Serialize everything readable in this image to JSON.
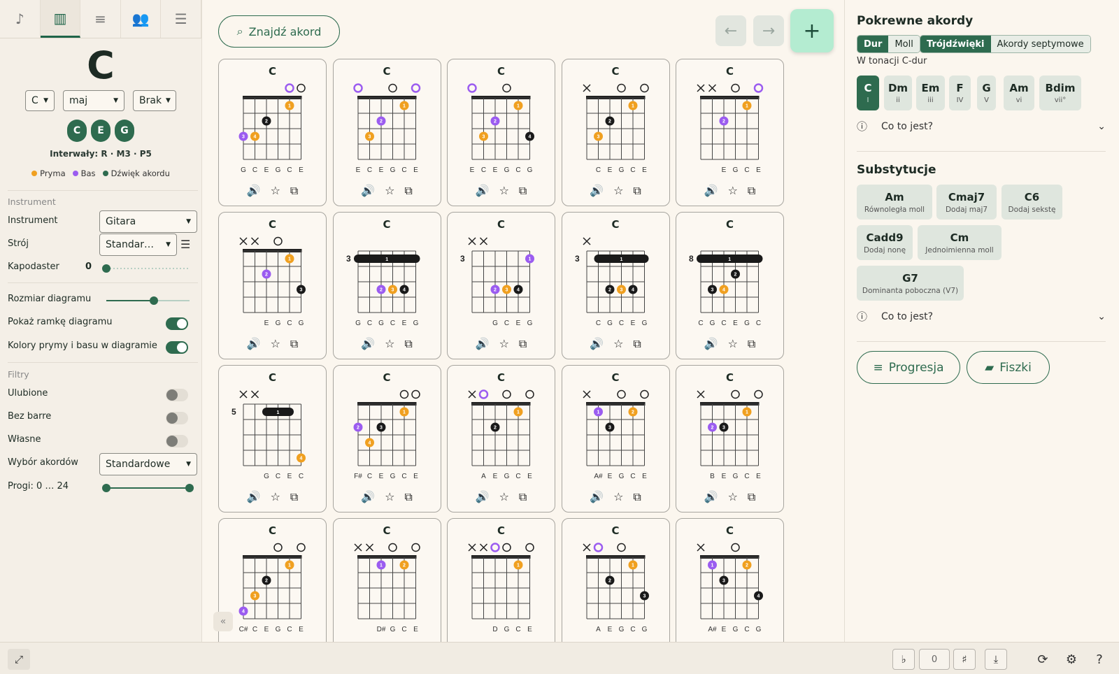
{
  "left": {
    "tabs": [
      "note-icon",
      "piano-icon",
      "playlist-icon",
      "people-icon",
      "sliders-icon"
    ],
    "chord_root": "C",
    "root_select": "C",
    "quality_select": "maj",
    "bass_select": "Brak",
    "notes": [
      "C",
      "E",
      "G"
    ],
    "intervals": "Interwały: R · M3 · P5",
    "legend": {
      "root": "Pryma",
      "bass": "Bas",
      "tone": "Dźwięk akordu"
    },
    "instrument_header": "Instrument",
    "instrument_label": "Instrument",
    "instrument_value": "Gitara",
    "tuning_label": "Strój",
    "tuning_value": "Standar…",
    "capo_label": "Kapodaster",
    "capo_value": "0",
    "size_label": "Rozmiar diagramu",
    "frame_label": "Pokaż ramkę diagramu",
    "colors_label": "Kolory prymy i basu w diagramie",
    "filters_header": "Filtry",
    "fav_label": "Ulubione",
    "nobarre_label": "Bez barre",
    "own_label": "Własne",
    "choice_label": "Wybór akordów",
    "choice_value": "Standardowe",
    "frets_label": "Progi: 0 … 24"
  },
  "center": {
    "find_label": "Znajdź akord",
    "chord_name": "C"
  },
  "right": {
    "related_title": "Pokrewne akordy",
    "seg1": [
      "Dur",
      "Moll"
    ],
    "seg2": [
      "Trójdźwięki",
      "Akordy septymowe"
    ],
    "key_label": "W tonacji C-dur",
    "keys": [
      {
        "name": "C",
        "deg": "I"
      },
      {
        "name": "Dm",
        "deg": "ii"
      },
      {
        "name": "Em",
        "deg": "iii"
      },
      {
        "name": "F",
        "deg": "IV"
      },
      {
        "name": "G",
        "deg": "V"
      },
      {
        "name": "Am",
        "deg": "vi"
      },
      {
        "name": "Bdim",
        "deg": "vii°"
      }
    ],
    "what_is": "Co to jest?",
    "subs_title": "Substytucje",
    "subs": [
      {
        "name": "Am",
        "desc": "Równoległa moll"
      },
      {
        "name": "Cmaj7",
        "desc": "Dodaj maj7"
      },
      {
        "name": "C6",
        "desc": "Dodaj sekstę"
      },
      {
        "name": "Cadd9",
        "desc": "Dodaj nonę"
      },
      {
        "name": "Cm",
        "desc": "Jednoimienna moll"
      },
      {
        "name": "G7",
        "desc": "Dominanta poboczna (V7)"
      }
    ],
    "what_is2": "Co to jest?",
    "progression_label": "Progresja",
    "flashcards_label": "Fiszki"
  },
  "bottom": {
    "flat": "♭",
    "transpose": "0",
    "sharp": "♯"
  },
  "colors": {
    "accent": "#2e6b4f",
    "root": "#f0a020",
    "bass": "#9b5cf0",
    "tone": "#1a1a1a"
  },
  "chords": [
    {
      "strings": [
        "",
        "",
        "",
        "",
        "B",
        "O"
      ],
      "fret": null,
      "barre": null,
      "dots": [
        [
          1,
          5,
          1,
          "r"
        ],
        [
          2,
          3,
          2,
          "t"
        ],
        [
          3,
          2,
          4,
          "r"
        ],
        [
          3,
          1,
          3,
          "b"
        ]
      ],
      "names": [
        "G",
        "C",
        "E",
        "G",
        "C",
        "E"
      ]
    },
    {
      "strings": [
        "B",
        "",
        "",
        "O",
        "",
        "B"
      ],
      "fret": null,
      "barre": null,
      "dots": [
        [
          1,
          5,
          1,
          "r"
        ],
        [
          2,
          3,
          2,
          "b"
        ],
        [
          3,
          2,
          3,
          "r"
        ]
      ],
      "names": [
        "E",
        "C",
        "E",
        "G",
        "C",
        "E"
      ]
    },
    {
      "strings": [
        "B",
        "",
        "",
        "O",
        "",
        ""
      ],
      "fret": null,
      "barre": null,
      "dots": [
        [
          1,
          5,
          1,
          "r"
        ],
        [
          2,
          3,
          2,
          "b"
        ],
        [
          3,
          2,
          3,
          "r"
        ],
        [
          3,
          6,
          4,
          "t"
        ]
      ],
      "names": [
        "E",
        "C",
        "E",
        "G",
        "C",
        "G"
      ]
    },
    {
      "strings": [
        "X",
        "",
        "",
        "O",
        "",
        "O"
      ],
      "fret": null,
      "barre": null,
      "dots": [
        [
          1,
          5,
          1,
          "r"
        ],
        [
          2,
          3,
          2,
          "t"
        ],
        [
          3,
          2,
          3,
          "r"
        ]
      ],
      "names": [
        "",
        "C",
        "E",
        "G",
        "C",
        "E"
      ]
    },
    {
      "strings": [
        "X",
        "X",
        "",
        "O",
        "",
        "B"
      ],
      "fret": null,
      "barre": null,
      "dots": [
        [
          1,
          5,
          1,
          "r"
        ],
        [
          2,
          3,
          2,
          "b"
        ]
      ],
      "names": [
        "",
        "",
        "E",
        "G",
        "C",
        "E"
      ]
    },
    {
      "strings": [
        "X",
        "X",
        "",
        "O",
        "",
        ""
      ],
      "fret": null,
      "barre": null,
      "dots": [
        [
          1,
          5,
          1,
          "r"
        ],
        [
          2,
          3,
          2,
          "b"
        ],
        [
          3,
          6,
          3,
          "t"
        ]
      ],
      "names": [
        "",
        "",
        "E",
        "G",
        "C",
        "G"
      ]
    },
    {
      "strings": [
        "",
        "",
        "",
        "",
        "",
        ""
      ],
      "fret": "3",
      "barre": [
        1,
        1,
        6
      ],
      "dots": [
        [
          3,
          3,
          2,
          "b"
        ],
        [
          3,
          4,
          3,
          "r"
        ],
        [
          3,
          5,
          4,
          "t"
        ]
      ],
      "names": [
        "G",
        "C",
        "G",
        "C",
        "E",
        "G"
      ]
    },
    {
      "strings": [
        "X",
        "X",
        "",
        "",
        "",
        ""
      ],
      "fret": "3",
      "barre": null,
      "dots": [
        [
          1,
          6,
          1,
          "b"
        ],
        [
          3,
          3,
          2,
          "b"
        ],
        [
          3,
          4,
          3,
          "r"
        ],
        [
          3,
          5,
          4,
          "t"
        ]
      ],
      "names": [
        "",
        "",
        "G",
        "C",
        "E",
        "G"
      ]
    },
    {
      "strings": [
        "X",
        "",
        "",
        "",
        "",
        ""
      ],
      "fret": "3",
      "barre": [
        1,
        2,
        6
      ],
      "dots": [
        [
          3,
          3,
          2,
          "t"
        ],
        [
          3,
          4,
          3,
          "r"
        ],
        [
          3,
          5,
          4,
          "t"
        ]
      ],
      "names": [
        "",
        "C",
        "G",
        "C",
        "E",
        "G"
      ]
    },
    {
      "strings": [
        "",
        "",
        "",
        "",
        "",
        ""
      ],
      "fret": "8",
      "barre": [
        1,
        1,
        6
      ],
      "dots": [
        [
          2,
          4,
          2,
          "t"
        ],
        [
          3,
          2,
          3,
          "t"
        ],
        [
          3,
          3,
          4,
          "r"
        ]
      ],
      "names": [
        "C",
        "G",
        "C",
        "E",
        "G",
        "C"
      ]
    },
    {
      "strings": [
        "X",
        "X",
        "",
        "",
        "",
        ""
      ],
      "fret": "5",
      "barre": [
        1,
        3,
        5
      ],
      "dots": [
        [
          4,
          6,
          4,
          "r"
        ]
      ],
      "names": [
        "",
        "",
        "G",
        "C",
        "E",
        "C"
      ]
    },
    {
      "strings": [
        "",
        "",
        "",
        "",
        "O",
        "O"
      ],
      "fret": null,
      "barre": null,
      "dots": [
        [
          1,
          5,
          1,
          "r"
        ],
        [
          2,
          1,
          2,
          "b"
        ],
        [
          2,
          3,
          3,
          "t"
        ],
        [
          3,
          2,
          4,
          "r"
        ]
      ],
      "names": [
        "F#",
        "C",
        "E",
        "G",
        "C",
        "E"
      ]
    },
    {
      "strings": [
        "X",
        "B",
        "",
        "O",
        "",
        "O"
      ],
      "fret": null,
      "barre": null,
      "dots": [
        [
          1,
          5,
          1,
          "r"
        ],
        [
          2,
          3,
          2,
          "t"
        ]
      ],
      "names": [
        "",
        "A",
        "E",
        "G",
        "C",
        "E"
      ]
    },
    {
      "strings": [
        "X",
        "",
        "",
        "O",
        "",
        "O"
      ],
      "fret": null,
      "barre": null,
      "dots": [
        [
          1,
          2,
          1,
          "b"
        ],
        [
          1,
          5,
          2,
          "r"
        ],
        [
          2,
          3,
          3,
          "t"
        ]
      ],
      "names": [
        "",
        "A#",
        "E",
        "G",
        "C",
        "E"
      ]
    },
    {
      "strings": [
        "X",
        "",
        "",
        "O",
        "",
        "O"
      ],
      "fret": null,
      "barre": null,
      "dots": [
        [
          1,
          5,
          1,
          "r"
        ],
        [
          2,
          2,
          2,
          "b"
        ],
        [
          2,
          3,
          3,
          "t"
        ]
      ],
      "names": [
        "",
        "B",
        "E",
        "G",
        "C",
        "E"
      ]
    },
    {
      "strings": [
        "",
        "",
        "",
        "O",
        "",
        "O"
      ],
      "fret": null,
      "barre": null,
      "dots": [
        [
          1,
          5,
          1,
          "r"
        ],
        [
          2,
          3,
          2,
          "t"
        ],
        [
          3,
          2,
          3,
          "r"
        ],
        [
          4,
          1,
          4,
          "b"
        ]
      ],
      "names": [
        "C#",
        "C",
        "E",
        "G",
        "C",
        "E"
      ]
    },
    {
      "strings": [
        "X",
        "X",
        "",
        "O",
        "",
        "O"
      ],
      "fret": null,
      "barre": null,
      "dots": [
        [
          1,
          3,
          1,
          "b"
        ],
        [
          1,
          5,
          2,
          "r"
        ]
      ],
      "names": [
        "",
        "",
        "D#",
        "G",
        "C",
        "E"
      ]
    },
    {
      "strings": [
        "X",
        "X",
        "B",
        "O",
        "",
        "O"
      ],
      "fret": null,
      "barre": null,
      "dots": [
        [
          1,
          5,
          1,
          "r"
        ]
      ],
      "names": [
        "",
        "",
        "D",
        "G",
        "C",
        "E"
      ]
    },
    {
      "strings": [
        "X",
        "B",
        "",
        "O",
        "",
        ""
      ],
      "fret": null,
      "barre": null,
      "dots": [
        [
          1,
          5,
          1,
          "r"
        ],
        [
          2,
          3,
          2,
          "t"
        ],
        [
          3,
          6,
          3,
          "t"
        ]
      ],
      "names": [
        "",
        "A",
        "E",
        "G",
        "C",
        "G"
      ]
    },
    {
      "strings": [
        "X",
        "",
        "",
        "O",
        "",
        ""
      ],
      "fret": null,
      "barre": null,
      "dots": [
        [
          1,
          2,
          1,
          "b"
        ],
        [
          1,
          5,
          2,
          "r"
        ],
        [
          2,
          3,
          3,
          "t"
        ],
        [
          3,
          6,
          4,
          "t"
        ]
      ],
      "names": [
        "",
        "A#",
        "E",
        "G",
        "C",
        "G"
      ]
    }
  ]
}
